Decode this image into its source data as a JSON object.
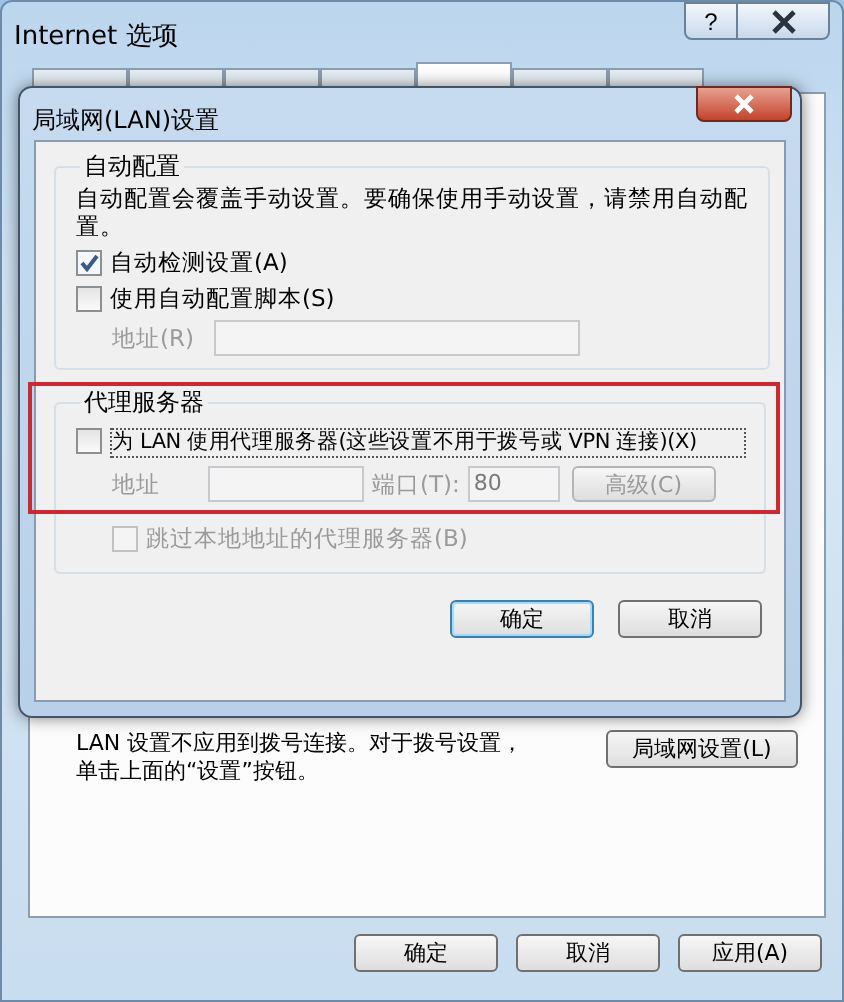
{
  "window": {
    "title": "Internet 选项",
    "help_button": "?"
  },
  "tabs": [
    {
      "selected": false
    },
    {
      "selected": false
    },
    {
      "selected": false
    },
    {
      "selected": false
    },
    {
      "selected": true
    },
    {
      "selected": false
    },
    {
      "selected": false
    }
  ],
  "dialog": {
    "title": "局域网(LAN)设置",
    "auto_config": {
      "title": "自动配置",
      "description": "自动配置会覆盖手动设置。要确保使用手动设置，请禁用自动配置。",
      "options": [
        {
          "label": "自动检测设置(A)",
          "checked": true
        },
        {
          "label": "使用自动配置脚本(S)",
          "checked": false
        }
      ],
      "address": {
        "label": "地址(R)",
        "disabled": true
      }
    },
    "proxy": {
      "title": "代理服务器",
      "highlighted": true,
      "use_proxy": {
        "label": "为 LAN 使用代理服务器(这些设置不用于拨号或 VPN 连接)(X)",
        "checked": false
      },
      "address": {
        "label": "地址",
        "disabled": true
      },
      "port": {
        "label": "端口(T):",
        "value": "80",
        "disabled": true
      },
      "advanced": {
        "label": "高级(C)",
        "disabled": true
      },
      "bypass": {
        "label": "跳过本地地址的代理服务器(B)",
        "checked": false,
        "disabled": true
      }
    },
    "buttons": [
      {
        "label": "确定",
        "default": true
      },
      {
        "label": "取消",
        "default": false
      }
    ]
  },
  "connections": {
    "note": "LAN 设置不应用到拨号连接。对于拨号设置，单击上面的“设置”按钮。",
    "lan_button": "局域网设置(L)"
  },
  "buttons": [
    "确定",
    "取消",
    "应用(A)"
  ]
}
